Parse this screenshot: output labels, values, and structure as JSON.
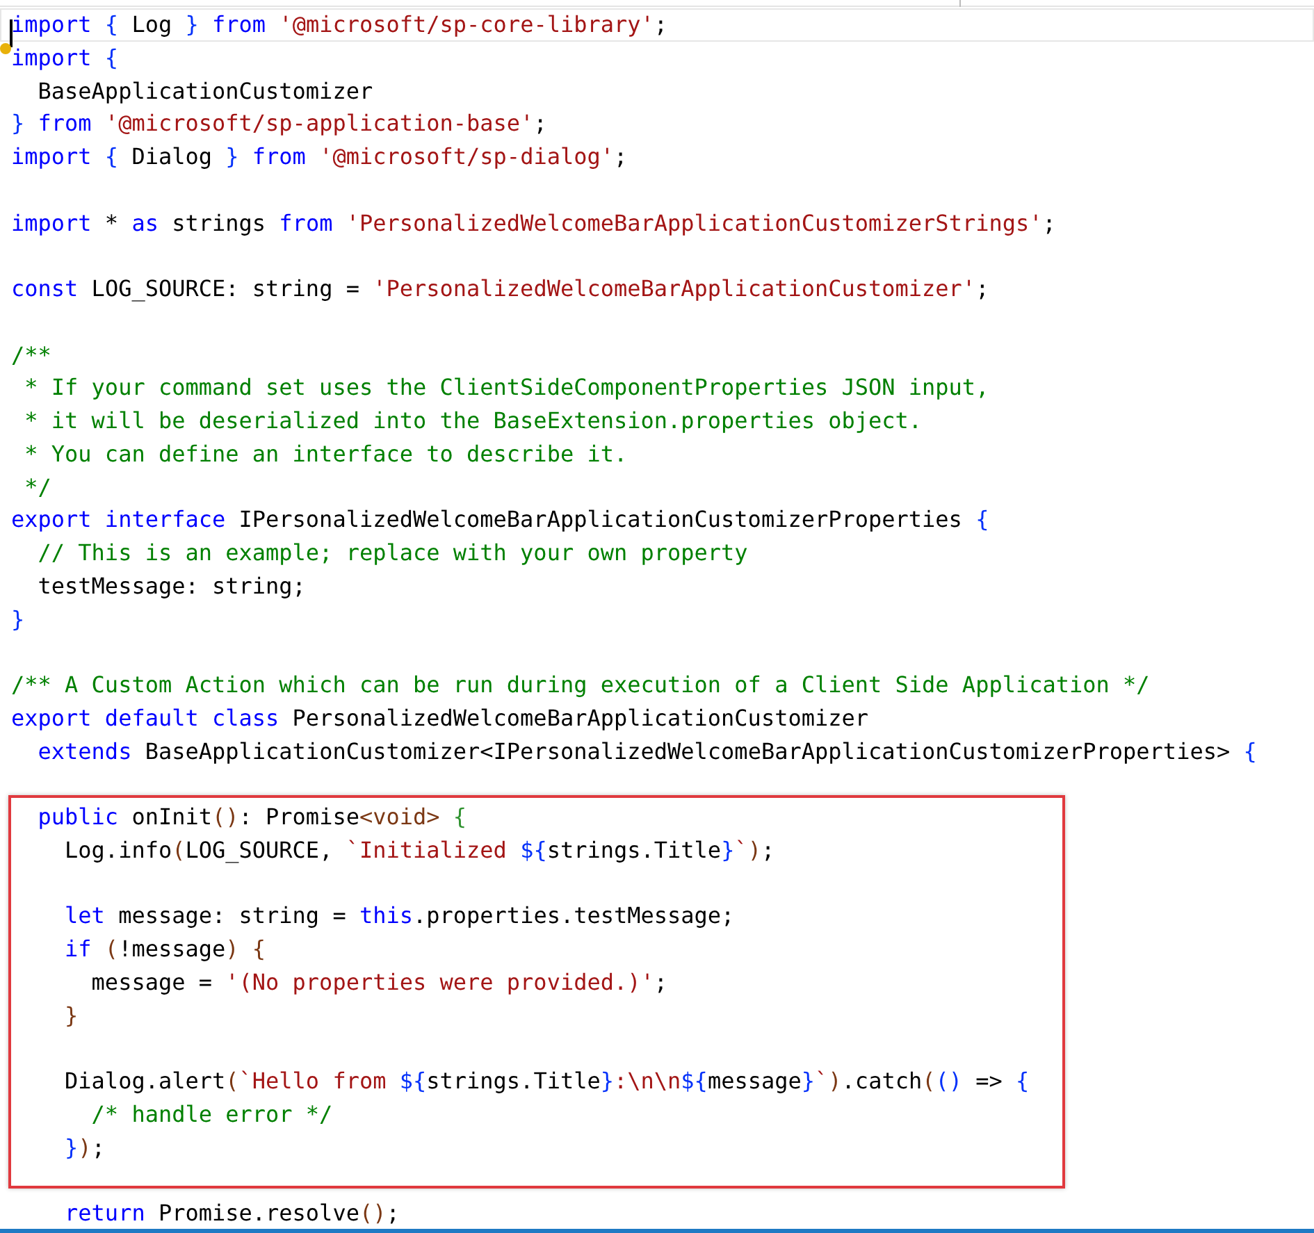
{
  "editor": {
    "blocks": [
      {
        "highlighted": false,
        "lines": [
          {
            "kind": "code",
            "current": true,
            "tokens": [
              {
                "kind": "keyword",
                "text": "import"
              },
              {
                "kind": "bracket1",
                "text": " {"
              },
              {
                "kind": "plain",
                "text": " Log "
              },
              {
                "kind": "bracket1",
                "text": "}"
              },
              {
                "kind": "keyword",
                "text": " from"
              },
              {
                "kind": "string",
                "text": " '@microsoft/sp-core-library'"
              },
              {
                "kind": "plain",
                "text": ";"
              }
            ]
          },
          {
            "kind": "code",
            "current": false,
            "tokens": [
              {
                "kind": "keyword",
                "text": "import"
              },
              {
                "kind": "bracket1",
                "text": " {"
              }
            ]
          },
          {
            "kind": "code",
            "current": false,
            "tokens": [
              {
                "kind": "plain",
                "text": "  BaseApplicationCustomizer"
              }
            ]
          },
          {
            "kind": "code",
            "current": false,
            "tokens": [
              {
                "kind": "bracket1",
                "text": "}"
              },
              {
                "kind": "keyword",
                "text": " from"
              },
              {
                "kind": "string",
                "text": " '@microsoft/sp-application-base'"
              },
              {
                "kind": "plain",
                "text": ";"
              }
            ]
          },
          {
            "kind": "code",
            "current": false,
            "tokens": [
              {
                "kind": "keyword",
                "text": "import"
              },
              {
                "kind": "bracket1",
                "text": " {"
              },
              {
                "kind": "plain",
                "text": " Dialog "
              },
              {
                "kind": "bracket1",
                "text": "}"
              },
              {
                "kind": "keyword",
                "text": " from"
              },
              {
                "kind": "string",
                "text": " '@microsoft/sp-dialog'"
              },
              {
                "kind": "plain",
                "text": ";"
              }
            ]
          },
          {
            "kind": "blank"
          },
          {
            "kind": "code",
            "current": false,
            "tokens": [
              {
                "kind": "keyword",
                "text": "import"
              },
              {
                "kind": "plain",
                "text": " * "
              },
              {
                "kind": "keyword",
                "text": "as"
              },
              {
                "kind": "plain",
                "text": " strings "
              },
              {
                "kind": "keyword",
                "text": "from"
              },
              {
                "kind": "string",
                "text": " 'PersonalizedWelcomeBarApplicationCustomizerStrings'"
              },
              {
                "kind": "plain",
                "text": ";"
              }
            ]
          },
          {
            "kind": "blank"
          },
          {
            "kind": "code",
            "current": false,
            "tokens": [
              {
                "kind": "keyword",
                "text": "const"
              },
              {
                "kind": "plain",
                "text": " LOG_SOURCE: string = "
              },
              {
                "kind": "string",
                "text": "'PersonalizedWelcomeBarApplicationCustomizer'"
              },
              {
                "kind": "plain",
                "text": ";"
              }
            ]
          },
          {
            "kind": "blank"
          },
          {
            "kind": "code",
            "current": false,
            "tokens": [
              {
                "kind": "comment",
                "text": "/**"
              }
            ]
          },
          {
            "kind": "code",
            "current": false,
            "tokens": [
              {
                "kind": "comment",
                "text": " * If your command set uses the ClientSideComponentProperties JSON input,"
              }
            ]
          },
          {
            "kind": "code",
            "current": false,
            "tokens": [
              {
                "kind": "comment",
                "text": " * it will be deserialized into the BaseExtension.properties object."
              }
            ]
          },
          {
            "kind": "code",
            "current": false,
            "tokens": [
              {
                "kind": "comment",
                "text": " * You can define an interface to describe it."
              }
            ]
          },
          {
            "kind": "code",
            "current": false,
            "tokens": [
              {
                "kind": "comment",
                "text": " */"
              }
            ]
          },
          {
            "kind": "code",
            "current": false,
            "tokens": [
              {
                "kind": "keyword",
                "text": "export"
              },
              {
                "kind": "keyword",
                "text": " interface"
              },
              {
                "kind": "plain",
                "text": " IPersonalizedWelcomeBarApplicationCustomizerProperties "
              },
              {
                "kind": "bracket1",
                "text": "{"
              }
            ]
          },
          {
            "kind": "code",
            "current": false,
            "tokens": [
              {
                "kind": "comment",
                "text": "  // This is an example; replace with your own property"
              }
            ]
          },
          {
            "kind": "code",
            "current": false,
            "tokens": [
              {
                "kind": "plain",
                "text": "  testMessage: string;"
              }
            ]
          },
          {
            "kind": "code",
            "current": false,
            "tokens": [
              {
                "kind": "bracket1",
                "text": "}"
              }
            ]
          },
          {
            "kind": "blank"
          },
          {
            "kind": "code",
            "current": false,
            "tokens": [
              {
                "kind": "comment",
                "text": "/** A Custom Action which can be run during execution of a Client Side Application */"
              }
            ]
          },
          {
            "kind": "code",
            "current": false,
            "tokens": [
              {
                "kind": "keyword",
                "text": "export"
              },
              {
                "kind": "keyword",
                "text": " default"
              },
              {
                "kind": "keyword",
                "text": " class"
              },
              {
                "kind": "plain",
                "text": " PersonalizedWelcomeBarApplicationCustomizer"
              }
            ]
          },
          {
            "kind": "code",
            "current": false,
            "tokens": [
              {
                "kind": "keyword",
                "text": "  extends"
              },
              {
                "kind": "plain",
                "text": " BaseApplicationCustomizer<IPersonalizedWelcomeBarApplicationCustomizerProperties> "
              },
              {
                "kind": "bracket1",
                "text": "{"
              }
            ]
          },
          {
            "kind": "blank"
          }
        ]
      },
      {
        "highlighted": true,
        "lines": [
          {
            "kind": "code",
            "current": false,
            "tokens": [
              {
                "kind": "keyword",
                "text": "  public"
              },
              {
                "kind": "plain",
                "text": " onInit"
              },
              {
                "kind": "bracket3",
                "text": "()"
              },
              {
                "kind": "plain",
                "text": ": Promise"
              },
              {
                "kind": "bracket3",
                "text": "<void>"
              },
              {
                "kind": "bracket2",
                "text": " {"
              }
            ]
          },
          {
            "kind": "code",
            "current": false,
            "tokens": [
              {
                "kind": "plain",
                "text": "    Log.info"
              },
              {
                "kind": "bracket3",
                "text": "("
              },
              {
                "kind": "plain",
                "text": "LOG_SOURCE, "
              },
              {
                "kind": "string",
                "text": "`Initialized "
              },
              {
                "kind": "bracket1",
                "text": "${"
              },
              {
                "kind": "plain",
                "text": "strings.Title"
              },
              {
                "kind": "bracket1",
                "text": "}"
              },
              {
                "kind": "string",
                "text": "`"
              },
              {
                "kind": "bracket3",
                "text": ")"
              },
              {
                "kind": "plain",
                "text": ";"
              }
            ]
          },
          {
            "kind": "blank"
          },
          {
            "kind": "code",
            "current": false,
            "tokens": [
              {
                "kind": "keyword",
                "text": "    let"
              },
              {
                "kind": "plain",
                "text": " message: string = "
              },
              {
                "kind": "keyword",
                "text": "this"
              },
              {
                "kind": "plain",
                "text": ".properties.testMessage;"
              }
            ]
          },
          {
            "kind": "code",
            "current": false,
            "tokens": [
              {
                "kind": "keyword",
                "text": "    if"
              },
              {
                "kind": "bracket3",
                "text": " ("
              },
              {
                "kind": "plain",
                "text": "!message"
              },
              {
                "kind": "bracket3",
                "text": ")"
              },
              {
                "kind": "bracket3",
                "text": " {"
              }
            ]
          },
          {
            "kind": "code",
            "current": false,
            "tokens": [
              {
                "kind": "plain",
                "text": "      message = "
              },
              {
                "kind": "string",
                "text": "'(No properties were provided.)'"
              },
              {
                "kind": "plain",
                "text": ";"
              }
            ]
          },
          {
            "kind": "code",
            "current": false,
            "tokens": [
              {
                "kind": "bracket3",
                "text": "    }"
              }
            ]
          },
          {
            "kind": "blank"
          },
          {
            "kind": "code",
            "current": false,
            "tokens": [
              {
                "kind": "plain",
                "text": "    Dialog.alert"
              },
              {
                "kind": "bracket3",
                "text": "("
              },
              {
                "kind": "string",
                "text": "`Hello from "
              },
              {
                "kind": "bracket1",
                "text": "${"
              },
              {
                "kind": "plain",
                "text": "strings.Title"
              },
              {
                "kind": "bracket1",
                "text": "}"
              },
              {
                "kind": "string",
                "text": ":\\n\\n"
              },
              {
                "kind": "bracket1",
                "text": "${"
              },
              {
                "kind": "plain",
                "text": "message"
              },
              {
                "kind": "bracket1",
                "text": "}"
              },
              {
                "kind": "string",
                "text": "`"
              },
              {
                "kind": "bracket3",
                "text": ")"
              },
              {
                "kind": "plain",
                "text": ".catch"
              },
              {
                "kind": "bracket3",
                "text": "("
              },
              {
                "kind": "bracket1",
                "text": "()"
              },
              {
                "kind": "plain",
                "text": " => "
              },
              {
                "kind": "bracket1",
                "text": "{"
              }
            ]
          },
          {
            "kind": "code",
            "current": false,
            "tokens": [
              {
                "kind": "comment",
                "text": "      /* handle error */"
              }
            ]
          },
          {
            "kind": "code",
            "current": false,
            "tokens": [
              {
                "kind": "bracket1",
                "text": "    }"
              },
              {
                "kind": "bracket3",
                "text": ")"
              },
              {
                "kind": "plain",
                "text": ";"
              }
            ]
          }
        ]
      },
      {
        "highlighted": false,
        "lines": [
          {
            "kind": "blank"
          },
          {
            "kind": "code",
            "current": false,
            "tokens": [
              {
                "kind": "keyword",
                "text": "    return"
              },
              {
                "kind": "plain",
                "text": " Promise.resolve"
              },
              {
                "kind": "bracket3",
                "text": "()"
              },
              {
                "kind": "plain",
                "text": ";"
              }
            ]
          }
        ]
      }
    ]
  }
}
